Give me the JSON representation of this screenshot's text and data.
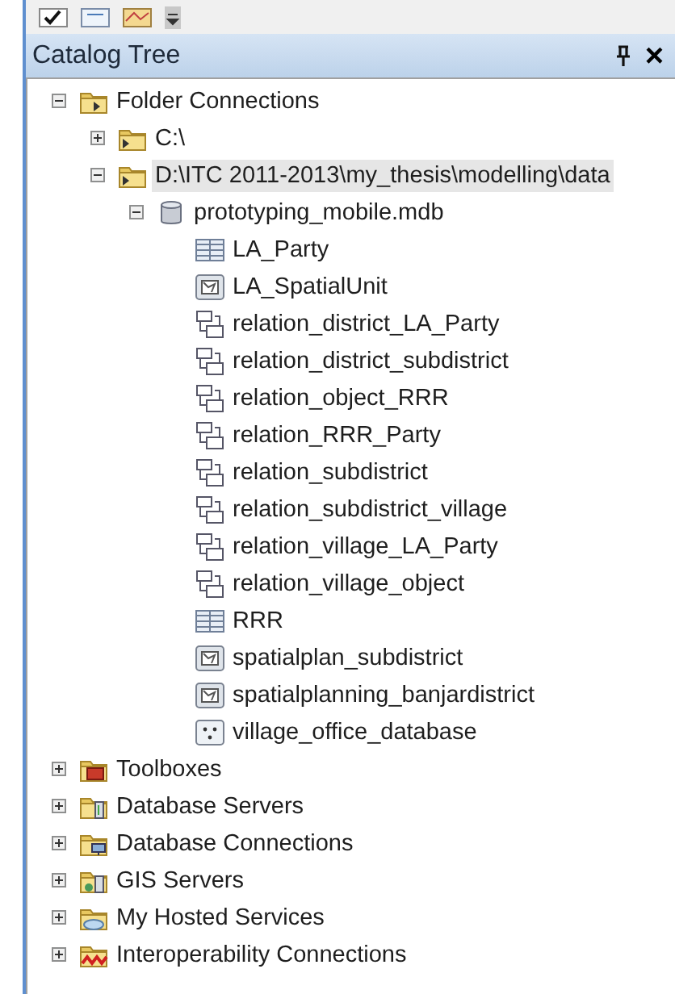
{
  "panel": {
    "title": "Catalog Tree",
    "close": "×"
  },
  "tree": [
    {
      "label": "Folder Connections",
      "kind": "folder-connections",
      "expanded": true,
      "selected": false,
      "children": [
        {
          "label": "C:\\",
          "kind": "folder",
          "expanded": false,
          "selected": false
        },
        {
          "label": "D:\\ITC 2011-2013\\my_thesis\\modelling\\data",
          "kind": "folder",
          "expanded": true,
          "selected": true,
          "children": [
            {
              "label": "prototyping_mobile.mdb",
              "kind": "database",
              "expanded": true,
              "selected": false,
              "children": [
                {
                  "label": "LA_Party",
                  "kind": "table",
                  "selected": false
                },
                {
                  "label": "LA_SpatialUnit",
                  "kind": "polygon",
                  "selected": false
                },
                {
                  "label": "relation_district_LA_Party",
                  "kind": "relationship",
                  "selected": false
                },
                {
                  "label": "relation_district_subdistrict",
                  "kind": "relationship",
                  "selected": false
                },
                {
                  "label": "relation_object_RRR",
                  "kind": "relationship",
                  "selected": false
                },
                {
                  "label": "relation_RRR_Party",
                  "kind": "relationship",
                  "selected": false
                },
                {
                  "label": "relation_subdistrict",
                  "kind": "relationship",
                  "selected": false
                },
                {
                  "label": "relation_subdistrict_village",
                  "kind": "relationship",
                  "selected": false
                },
                {
                  "label": "relation_village_LA_Party",
                  "kind": "relationship",
                  "selected": false
                },
                {
                  "label": "relation_village_object",
                  "kind": "relationship",
                  "selected": false
                },
                {
                  "label": "RRR",
                  "kind": "table",
                  "selected": false
                },
                {
                  "label": "spatialplan_subdistrict",
                  "kind": "polygon",
                  "selected": false
                },
                {
                  "label": "spatialplanning_banjardistrict",
                  "kind": "polygon",
                  "selected": false
                },
                {
                  "label": "village_office_database",
                  "kind": "point",
                  "selected": false
                }
              ]
            }
          ]
        }
      ]
    },
    {
      "label": "Toolboxes",
      "kind": "toolboxes",
      "expanded": false,
      "selected": false
    },
    {
      "label": "Database Servers",
      "kind": "servers",
      "expanded": false,
      "selected": false
    },
    {
      "label": "Database Connections",
      "kind": "connections",
      "expanded": false,
      "selected": false
    },
    {
      "label": "GIS Servers",
      "kind": "gis-servers",
      "expanded": false,
      "selected": false
    },
    {
      "label": "My Hosted Services",
      "kind": "hosted",
      "expanded": false,
      "selected": false
    },
    {
      "label": "Interoperability Connections",
      "kind": "interop",
      "expanded": false,
      "selected": false
    }
  ]
}
